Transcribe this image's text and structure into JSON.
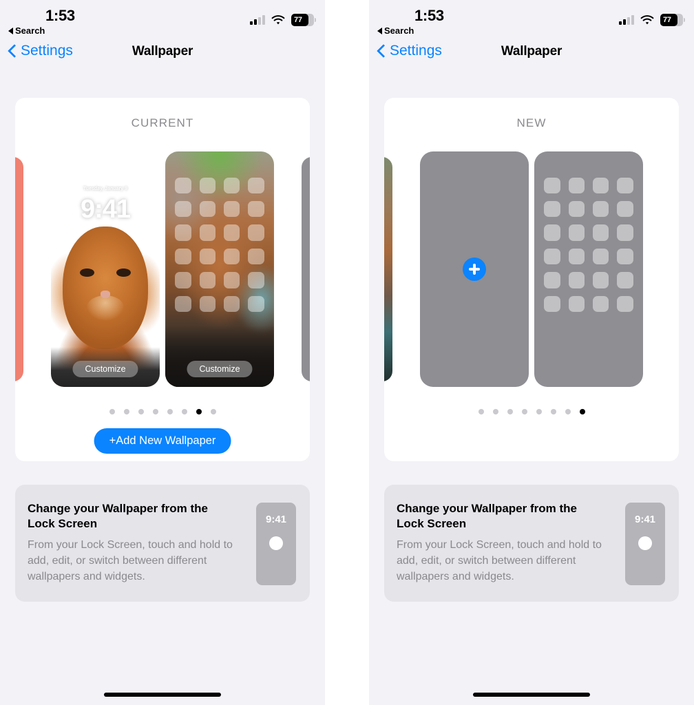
{
  "status_bar": {
    "time": "1:53",
    "back_label": "Search",
    "battery_level": "77",
    "signal_icon": "cellular-signal-icon",
    "wifi_icon": "wifi-icon",
    "battery_icon": "battery-icon"
  },
  "nav": {
    "back_label": "Settings",
    "title": "Wallpaper",
    "back_icon": "chevron-left-icon"
  },
  "colors": {
    "accent": "#0a84ff",
    "page_bg": "#f2f2f7",
    "card_bg": "#ffffff",
    "info_bg": "#e4e4e9",
    "placeholder": "#8e8e93",
    "dot_inactive": "#c9c9ce",
    "dot_active": "#000000"
  },
  "panels": [
    {
      "id": "current-state",
      "gallery_title": "CURRENT",
      "state": "current",
      "lock_preview": {
        "date": "Tuesday, January 9",
        "time": "9:41",
        "customize_label": "Customize"
      },
      "home_preview": {
        "customize_label": "Customize",
        "icon_count": 24
      },
      "peek_left_color": "#f08070",
      "peek_right_color": "#8e8e93",
      "dots": {
        "count": 8,
        "active_index": 6
      },
      "add_button_label": "+Add New Wallpaper",
      "add_button_visible": true
    },
    {
      "id": "new-state",
      "gallery_title": "NEW",
      "state": "new",
      "lock_preview": {
        "plus_icon": "plus-icon"
      },
      "home_preview": {
        "icon_count": 24
      },
      "peek_left_color": "#6d5a52",
      "peek_right_color": "#8e8e93",
      "dots": {
        "count": 8,
        "active_index": 7
      },
      "add_button_label": "",
      "add_button_visible": false
    }
  ],
  "info_card": {
    "title": "Change your Wallpaper from the Lock Screen",
    "body": "From your Lock Screen, touch and hold to add, edit, or switch between different wallpapers and widgets.",
    "thumb_time": "9:41"
  }
}
